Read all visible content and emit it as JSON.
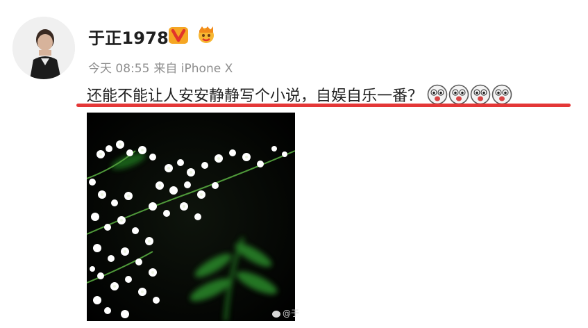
{
  "post": {
    "username": "于正1978",
    "timestamp": "今天 08:55",
    "source": "来自 iPhone X",
    "text": "还能不能让人安安静静写个小说，自娱自乐一番？",
    "emoji_count": 4,
    "image_watermark": "@于"
  },
  "icons": {
    "avatar": "user-avatar-photo",
    "verified": "v-badge-icon",
    "crown": "vip-crown-icon",
    "emoji": "surprised-face-emoji"
  },
  "colors": {
    "accent": "#e43737",
    "verified_badge": "#f5a623",
    "crown": "#f7b733"
  }
}
